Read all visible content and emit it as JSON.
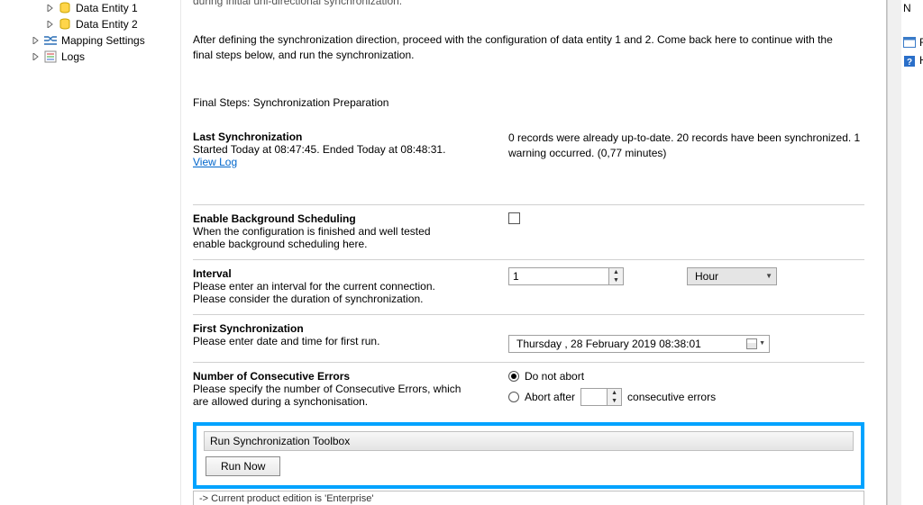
{
  "tree": {
    "items": [
      {
        "label": "Data Entity 1",
        "icon": "db"
      },
      {
        "label": "Data Entity 2",
        "icon": "db"
      },
      {
        "label": "Mapping Settings",
        "icon": "mapping"
      },
      {
        "label": "Logs",
        "icon": "logs"
      }
    ]
  },
  "main": {
    "truncated_top": "during initial uni-directional synchronization.",
    "after_defining": "After defining the synchronization direction, proceed with the configuration of data entity 1 and 2. Come back here to continue with the final steps below, and run the synchronization.",
    "final_steps_heading": "Final Steps: Synchronization Preparation",
    "last_sync": {
      "heading": "Last Synchronization",
      "started": "Started  Today at 08:47:45. Ended Today at 08:48:31.",
      "view_log": "View Log",
      "status": "0 records were already up-to-date. 20 records have been synchronized. 1 warning occurred. (0,77 minutes)"
    },
    "enable_bg": {
      "heading": "Enable Background Scheduling",
      "line1": "When the configuration is finished and well tested",
      "line2": "enable background scheduling here.",
      "checked": false
    },
    "interval": {
      "heading": "Interval",
      "line1": "Please enter an interval for the current connection.",
      "line2": "Please consider the duration of synchronization.",
      "value": "1",
      "unit": "Hour"
    },
    "first_sync": {
      "heading": "First Synchronization",
      "line1": "Please enter date and time for first run.",
      "datetime": "Thursday  , 28   February    2019 08:38:01"
    },
    "consecutive": {
      "heading": "Number of Consecutive Errors",
      "line1": "Please specify the number of Consecutive Errors, which",
      "line2": "are allowed during a synchonisation.",
      "opt1": "Do not abort",
      "opt2_prefix": "Abort after",
      "opt2_suffix": "consecutive errors",
      "abort_value": ""
    },
    "toolbox": {
      "title": "Run Synchronization Toolbox",
      "run_now": "Run Now"
    },
    "footer": "-> Current product edition is 'Enterprise'"
  },
  "right": {
    "letters": [
      "N",
      "R",
      "H"
    ]
  }
}
